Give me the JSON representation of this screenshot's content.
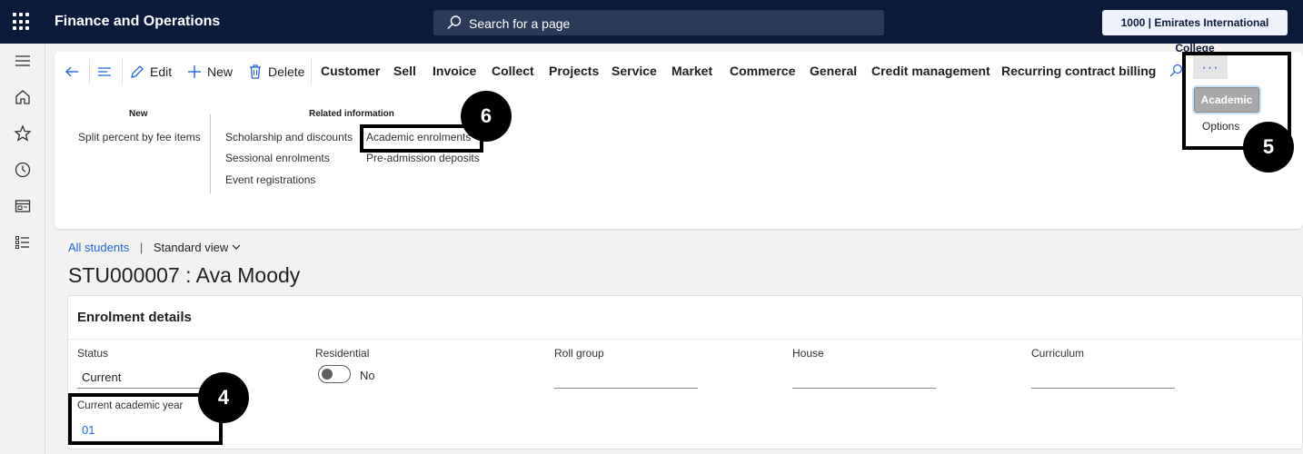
{
  "app": {
    "title": "Finance and Operations",
    "search_placeholder": "Search for a page",
    "company": "1000 | Emirates International College"
  },
  "leftnav": {
    "icons": [
      "hamburger-icon",
      "home-icon",
      "star-icon",
      "clock-icon",
      "workspace-icon",
      "list-icon"
    ]
  },
  "toolbar": {
    "edit": "Edit",
    "new": "New",
    "delete": "Delete",
    "tabs": [
      "Customer",
      "Sell",
      "Invoice",
      "Collect",
      "Projects",
      "Service",
      "Market",
      "Commerce",
      "General",
      "Credit management",
      "Recurring contract billing"
    ],
    "more": "···"
  },
  "ribbon": {
    "new_group": {
      "title": "New",
      "items": [
        "Split percent by fee items"
      ]
    },
    "related_group": {
      "title": "Related information",
      "col1": [
        "Scholarship and discounts",
        "Sessional enrolments",
        "Event registrations"
      ],
      "col2": [
        "Academic enrolments",
        "Pre-admission deposits"
      ]
    }
  },
  "dropdown": {
    "academic": "Academic",
    "options": "Options"
  },
  "annotations": {
    "n4": "4",
    "n5": "5",
    "n6": "6"
  },
  "breadcrumb": {
    "link": "All students",
    "separator": "|",
    "view": "Standard view"
  },
  "page_title": "STU000007 : Ava Moody",
  "enrolment": {
    "title": "Enrolment details",
    "status_label": "Status",
    "status_value": "Current",
    "residential_label": "Residential",
    "residential_value": "No",
    "roll_group_label": "Roll group",
    "house_label": "House",
    "curriculum_label": "Curriculum",
    "academic_year_label": "Current academic year",
    "academic_year_value": "01"
  },
  "colors": {
    "topbar": "#0b1a3a",
    "accent": "#2266e3"
  }
}
